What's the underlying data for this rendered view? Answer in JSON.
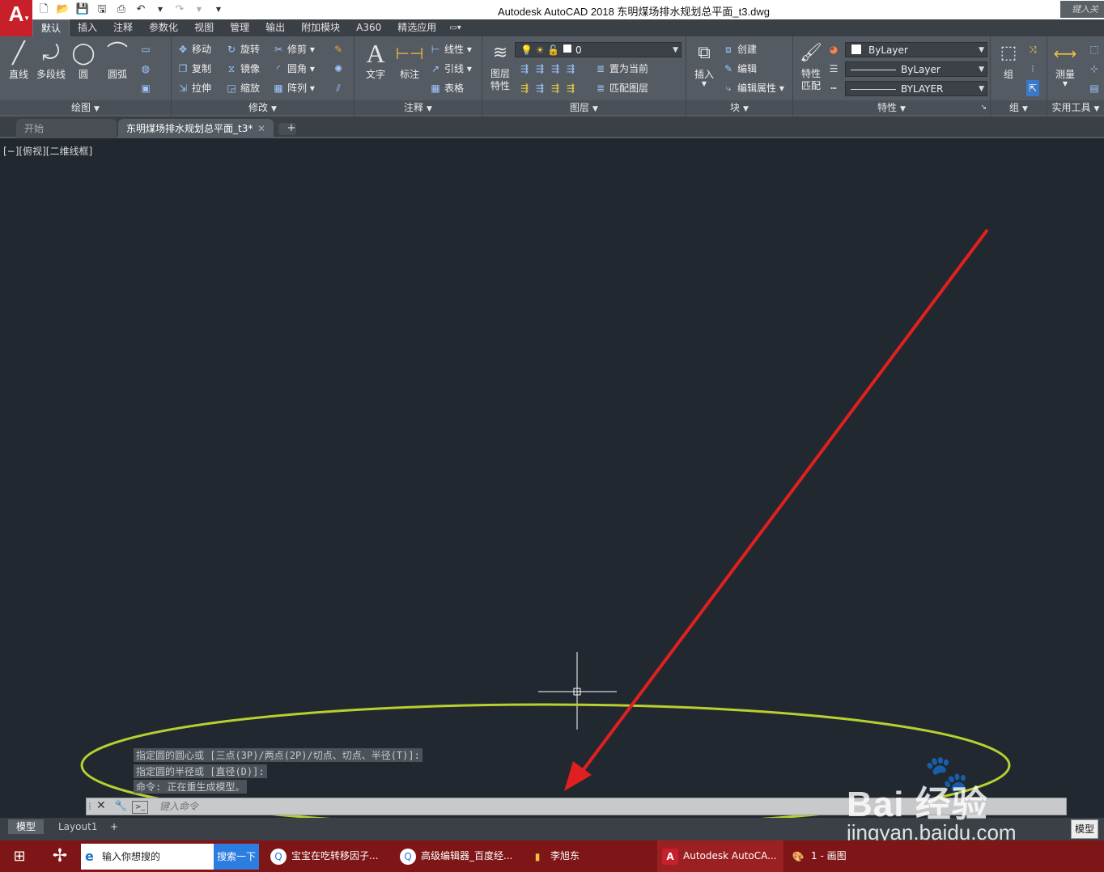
{
  "window": {
    "title": "Autodesk AutoCAD 2018    东明煤场排水规划总平面_t3.dwg",
    "search_placeholder": "键入关"
  },
  "ribbon_tabs": [
    "默认",
    "插入",
    "注释",
    "参数化",
    "视图",
    "管理",
    "输出",
    "附加模块",
    "A360",
    "精选应用"
  ],
  "panels": {
    "draw": {
      "title": "绘图",
      "line": "直线",
      "polyline": "多段线",
      "circle": "圆",
      "arc": "圆弧"
    },
    "modify": {
      "title": "修改",
      "move": "移动",
      "rotate": "旋转",
      "trim": "修剪",
      "copy": "复制",
      "mirror": "镜像",
      "fillet": "圆角",
      "stretch": "拉伸",
      "scale": "缩放",
      "array": "阵列"
    },
    "annotation": {
      "title": "注释",
      "text": "文字",
      "dimension": "标注",
      "linear": "线性",
      "leader": "引线",
      "table": "表格"
    },
    "layers": {
      "title": "图层",
      "layer_props_1": "图层",
      "layer_props_2": "特性",
      "current_layer": "0",
      "set_current": "置为当前",
      "match_layer": "匹配图层"
    },
    "block": {
      "title": "块",
      "insert": "插入",
      "create": "创建",
      "edit": "编辑",
      "edit_attributes": "编辑属性"
    },
    "properties": {
      "title": "特性",
      "match_1": "特性",
      "match_2": "匹配",
      "color": "ByLayer",
      "linetype": "ByLayer",
      "lineweight": "BYLAYER"
    },
    "groups": {
      "title": "组",
      "group": "组"
    },
    "utilities": {
      "title": "实用工具",
      "measure": "测量"
    }
  },
  "file_tabs": {
    "start": "开始",
    "document": "东明煤场排水规划总平面_t3*",
    "add": "+"
  },
  "viewport": {
    "label": "[−][俯视][二维线框]"
  },
  "command": {
    "history": [
      "指定圆的圆心或 [三点(3P)/两点(2P)/切点、切点、半径(T)]:",
      "指定圆的半径或 [直径(D)]:",
      "命令: 正在重生成模型。"
    ],
    "input_placeholder": "键入命令"
  },
  "layout_tabs": {
    "model": "模型",
    "layout1": "Layout1",
    "add": "+"
  },
  "status": {
    "model": "模型"
  },
  "taskbar": {
    "search_text": "输入你想搜的",
    "search_button": "搜索一下",
    "items": [
      "宝宝在吃转移因子...",
      "高级编辑器_百度经...",
      "李旭东",
      "Autodesk AutoCA...",
      "1 - 画图"
    ]
  },
  "watermark": {
    "logo": "Bai  经验",
    "url": "jingyan.baidu.com"
  },
  "colors": {
    "accent": "#c8202a",
    "annotation_arrow": "#e02020",
    "annotation_ellipse": "#b8d030",
    "canvas": "#212830"
  }
}
